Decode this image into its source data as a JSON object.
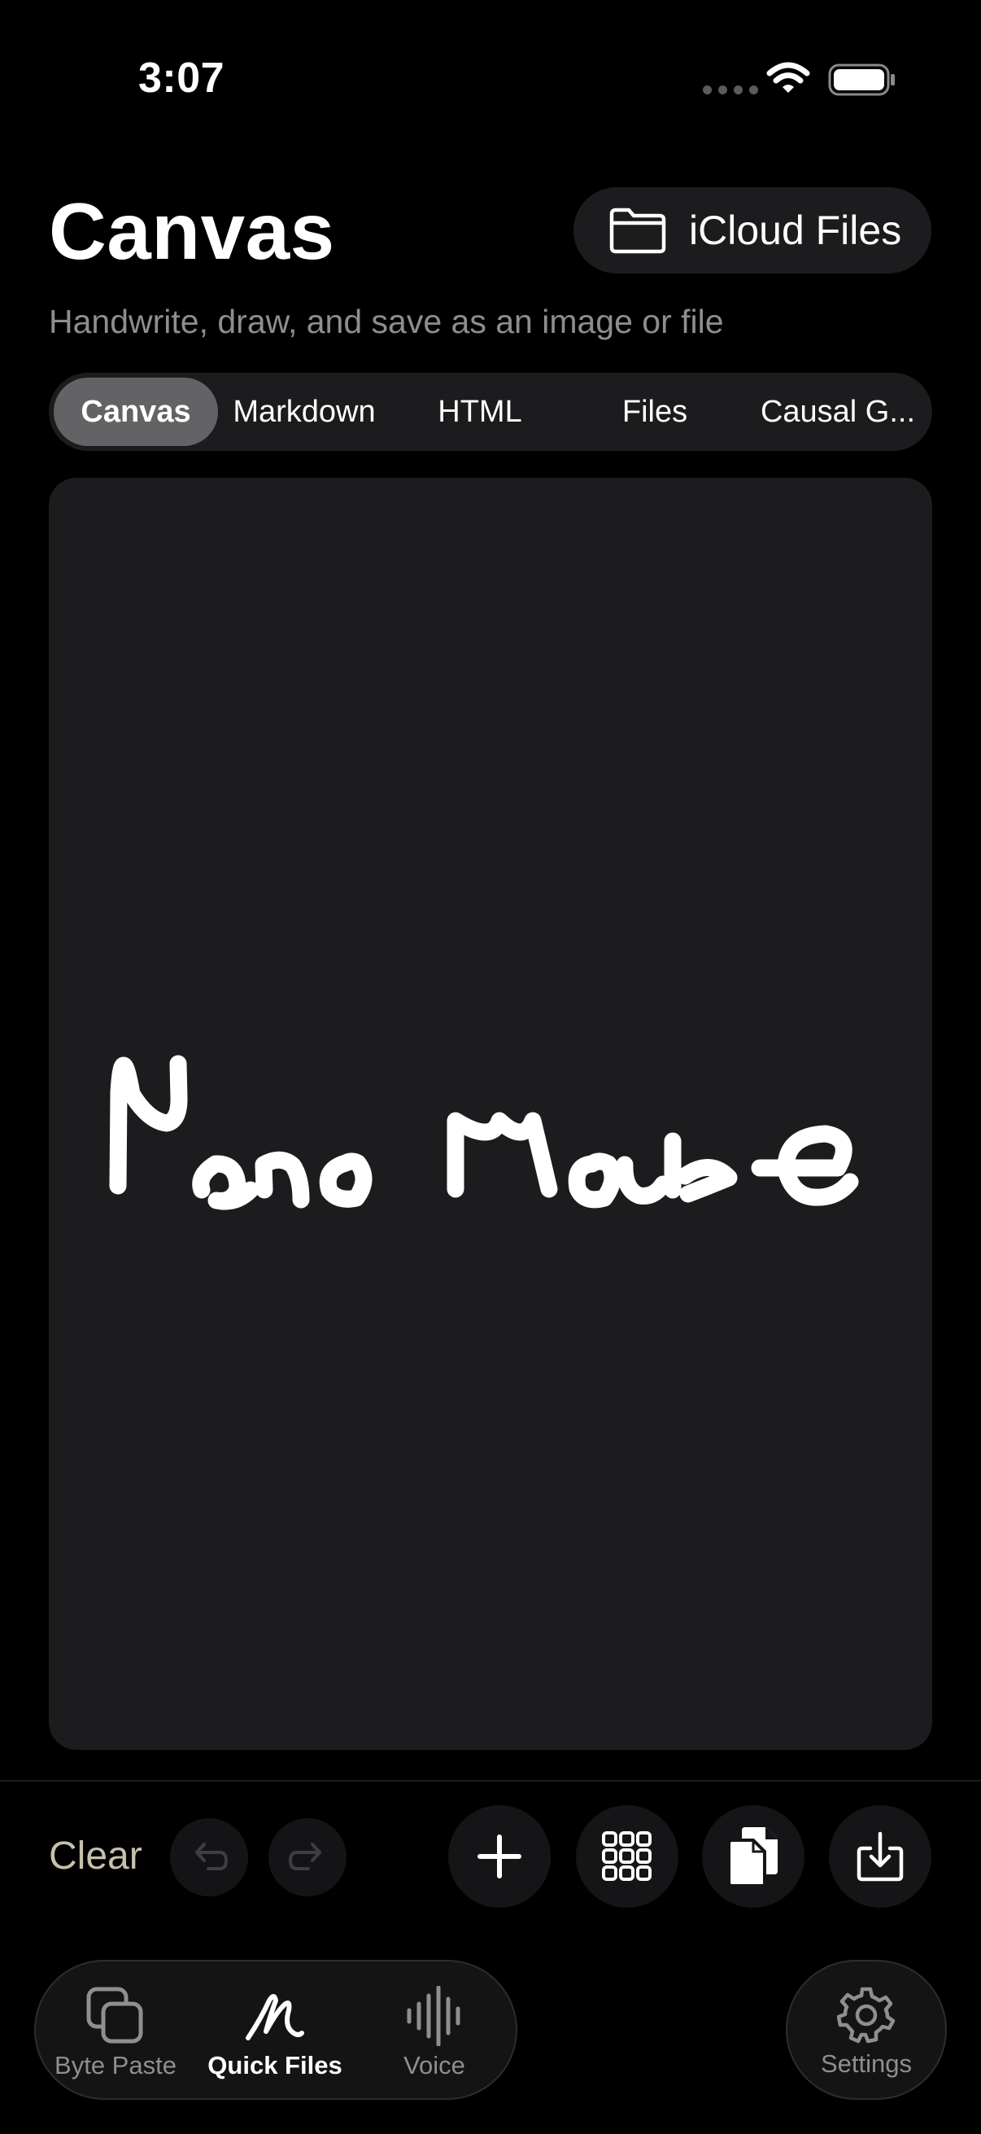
{
  "status_bar": {
    "time": "3:07"
  },
  "header": {
    "title": "Canvas",
    "icloud_button_label": "iCloud Files",
    "subtitle": "Handwrite, draw, and save as an image or file"
  },
  "segments": [
    {
      "label": "Canvas",
      "active": true
    },
    {
      "label": "Markdown",
      "active": false
    },
    {
      "label": "HTML",
      "active": false
    },
    {
      "label": "Files",
      "active": false
    },
    {
      "label": "Causal G...",
      "active": false
    }
  ],
  "canvas": {
    "drawing_text": "NanoMouse"
  },
  "toolbar": {
    "clear_label": "Clear",
    "icons": [
      "undo-icon",
      "redo-icon",
      "plus-icon",
      "grid-icon",
      "copy-icon",
      "download-icon"
    ]
  },
  "tabbar": {
    "tabs": [
      {
        "label": "Byte Paste",
        "icon": "byte-paste-icon",
        "active": false
      },
      {
        "label": "Quick Files",
        "icon": "scribble-icon",
        "active": true
      },
      {
        "label": "Voice",
        "icon": "waveform-icon",
        "active": false
      }
    ],
    "settings_label": "Settings"
  },
  "colors": {
    "background": "#000000",
    "surface": "#1c1c1e",
    "segment_active": "#636366",
    "secondary_text": "#8d8d92",
    "clear_text": "#c7c0aa"
  }
}
